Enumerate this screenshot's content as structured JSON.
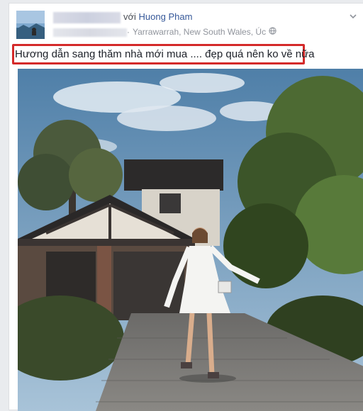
{
  "post": {
    "with_prefix": "với",
    "tagged_name": "Huong Pham",
    "location": "Yarrawarrah, New South Wales, Úc",
    "location_separator": "·",
    "caption": "Hương dẫn sang thăm nhà mới mua .... đẹp quá nên ko về nữa"
  },
  "icons": {
    "privacy": "globe-icon",
    "menu": "chevron-down-icon"
  },
  "colors": {
    "link": "#365899",
    "highlight_border": "#d42a2a",
    "meta_text": "#90949c"
  }
}
